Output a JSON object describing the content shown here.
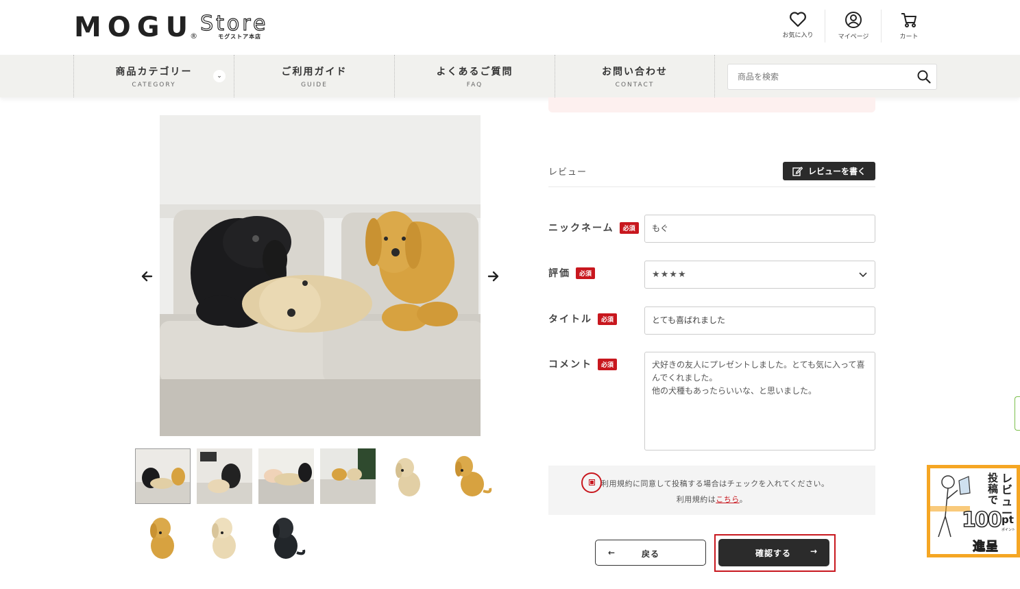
{
  "header": {
    "logo_main": "MOGU",
    "logo_reg": "®",
    "logo_store": "Store",
    "logo_sub": "モグストア本店",
    "icons": [
      {
        "name": "heart-icon",
        "label": "お気に入り"
      },
      {
        "name": "user-icon",
        "label": "マイページ"
      },
      {
        "name": "cart-icon",
        "label": "カート"
      }
    ]
  },
  "nav": {
    "items": [
      {
        "jp": "商品カテゴリー",
        "en": "CATEGORY"
      },
      {
        "jp": "ご利用ガイド",
        "en": "GUIDE"
      },
      {
        "jp": "よくあるご質問",
        "en": "FAQ"
      },
      {
        "jp": "お問い合わせ",
        "en": "CONTACT"
      }
    ],
    "category_toggle": "⌄",
    "search_placeholder": "商品を検索"
  },
  "review": {
    "section_label": "レビュー",
    "write_button": "レビューを書く",
    "required_badge": "必須",
    "fields": {
      "nickname_label": "ニックネーム",
      "nickname_value": "もぐ",
      "rating_label": "評価",
      "rating_value": "★★★★",
      "title_label": "タイトル",
      "title_value": "とても喜ばれました",
      "comment_label": "コメント",
      "comment_value": "犬好きの友人にプレゼントしました。とても気に入って喜んでくれました。\n他の犬種もあったらいいな、と思いました。"
    },
    "agree_text": "利用規約に同意して投稿する場合はチェックを入れてください。",
    "terms_prefix": "利用規約は",
    "terms_link": "こちら",
    "terms_suffix": "。",
    "terms_checked": true,
    "back_button": "戻る",
    "confirm_button": "確認する"
  },
  "banner": {
    "line1": "レビュー",
    "line2": "投稿で",
    "amount": "100",
    "unit": "pt",
    "unit_sub": "ポイント",
    "line3": "進呈"
  },
  "colors": {
    "accent_red": "#c8171e",
    "dark_button": "#2b2b2b",
    "nav_bg": "#f1f1ee",
    "banner_orange": "#f5a623"
  }
}
